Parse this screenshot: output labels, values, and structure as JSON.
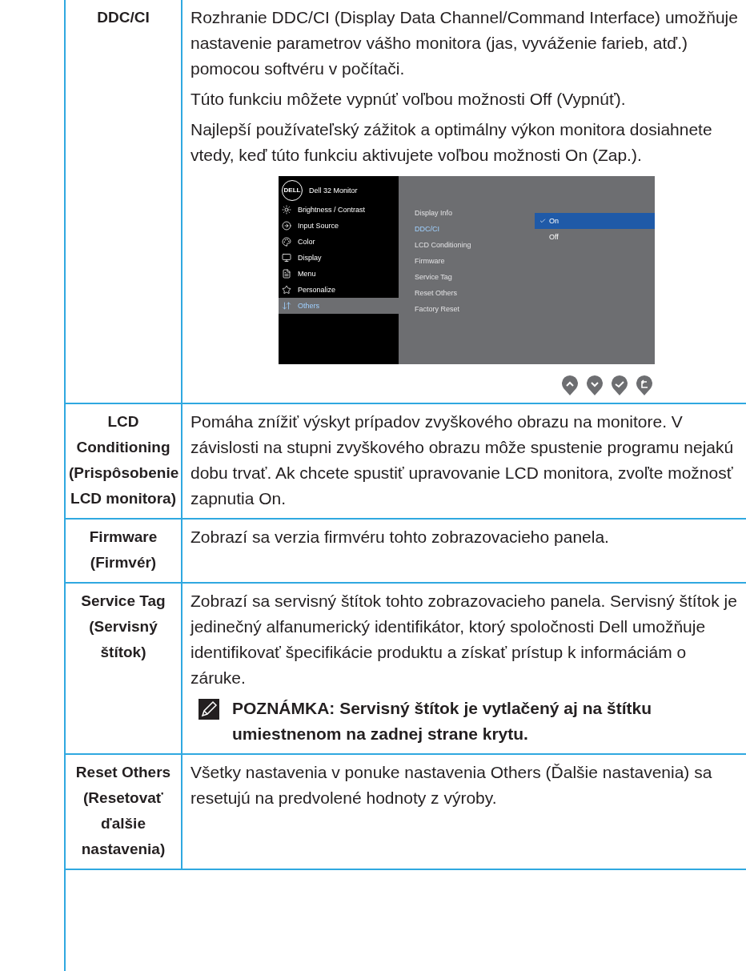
{
  "rows": [
    {
      "label": "DDC/CI",
      "paragraphs": [
        "Rozhranie DDC/CI (Display Data Channel/Command Interface) umožňuje nastavenie parametrov vášho monitora (jas, vyváženie farieb, atď.) pomocou softvéru v počítači.",
        "Túto funkciu môžete vypnúť voľbou možnosti Off (Vypnúť).",
        "Najlepší používateľský zážitok a optimálny výkon monitora dosiahnete vtedy, keď túto funkciu aktivujete voľbou možnosti On (Zap.)."
      ],
      "osd": {
        "logo": "DELL",
        "title": "Dell 32 Monitor",
        "menu": [
          {
            "label": "Brightness / Contrast",
            "selected": false
          },
          {
            "label": "Input Source",
            "selected": false
          },
          {
            "label": "Color",
            "selected": false
          },
          {
            "label": "Display",
            "selected": false
          },
          {
            "label": "Menu",
            "selected": false
          },
          {
            "label": "Personalize",
            "selected": false
          },
          {
            "label": "Others",
            "selected": true
          }
        ],
        "submenu": [
          {
            "label": "Display Info",
            "selected": false
          },
          {
            "label": "DDC/CI",
            "selected": true
          },
          {
            "label": "LCD Conditioning",
            "selected": false
          },
          {
            "label": "Firmware",
            "selected": false
          },
          {
            "label": "Service Tag",
            "selected": false
          },
          {
            "label": "Reset Others",
            "selected": false
          },
          {
            "label": "Factory Reset",
            "selected": false
          }
        ],
        "options": [
          {
            "label": "On",
            "selected": true
          },
          {
            "label": "Off",
            "selected": false
          }
        ]
      }
    },
    {
      "label": "LCD Conditioning (Prispôsobenie LCD monitora)",
      "paragraphs": [
        "Pomáha znížiť výskyt prípadov zvyškového obrazu na monitore. V závislosti na stupni zvyškového obrazu môže spustenie programu nejakú dobu trvať. Ak chcete spustiť upravovanie LCD monitora, zvoľte možnosť zapnutia On."
      ]
    },
    {
      "label": "Firmware (Firmvér)",
      "paragraphs": [
        "Zobrazí sa verzia firmvéru tohto zobrazovacieho panela."
      ]
    },
    {
      "label": "Service Tag (Servisný štítok)",
      "paragraphs": [
        "Zobrazí sa servisný štítok tohto zobrazovacieho panela. Servisný štítok je jedinečný alfanumerický identifikátor, ktorý spoločnosti Dell umožňuje identifikovať špecifikácie produktu a získať prístup k informáciám o záruke."
      ],
      "note": "POZNÁMKA: Servisný štítok je vytlačený aj na štítku umiestnenom na zadnej strane krytu."
    },
    {
      "label": "Reset Others (Resetovať ďalšie nastavenia)",
      "paragraphs": [
        "Všetky nastavenia v ponuke nastavenia Others (Ďalšie nastavenia) sa resetujú na predvolené hodnoty z výroby."
      ]
    }
  ]
}
